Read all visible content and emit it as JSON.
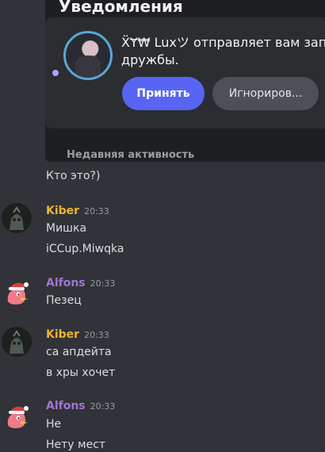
{
  "notification": {
    "title": "Уведомления",
    "line1": "ẌɎ₩ Luxツ отправляет вам запро",
    "line2": "дружбы.",
    "accept": "Принять",
    "ignore": "Игнориров...",
    "recent": "Недавняя активность"
  },
  "messages": [
    {
      "text": "Кто это?)"
    },
    {
      "author": "Kiber",
      "color": "#f0b232",
      "time": "20:33",
      "lines": [
        "Мишка",
        "iCCup.Miwqka"
      ]
    },
    {
      "author": "Alfons",
      "color": "#a374d4",
      "time": "20:33",
      "lines": [
        "Пезец"
      ]
    },
    {
      "author": "Kiber",
      "color": "#f0b232",
      "time": "20:33",
      "lines": [
        "са апдейта",
        "в хры хочет"
      ]
    },
    {
      "author": "Alfons",
      "color": "#a374d4",
      "time": "20:33",
      "lines": [
        "Не",
        "Нету мест"
      ]
    }
  ]
}
